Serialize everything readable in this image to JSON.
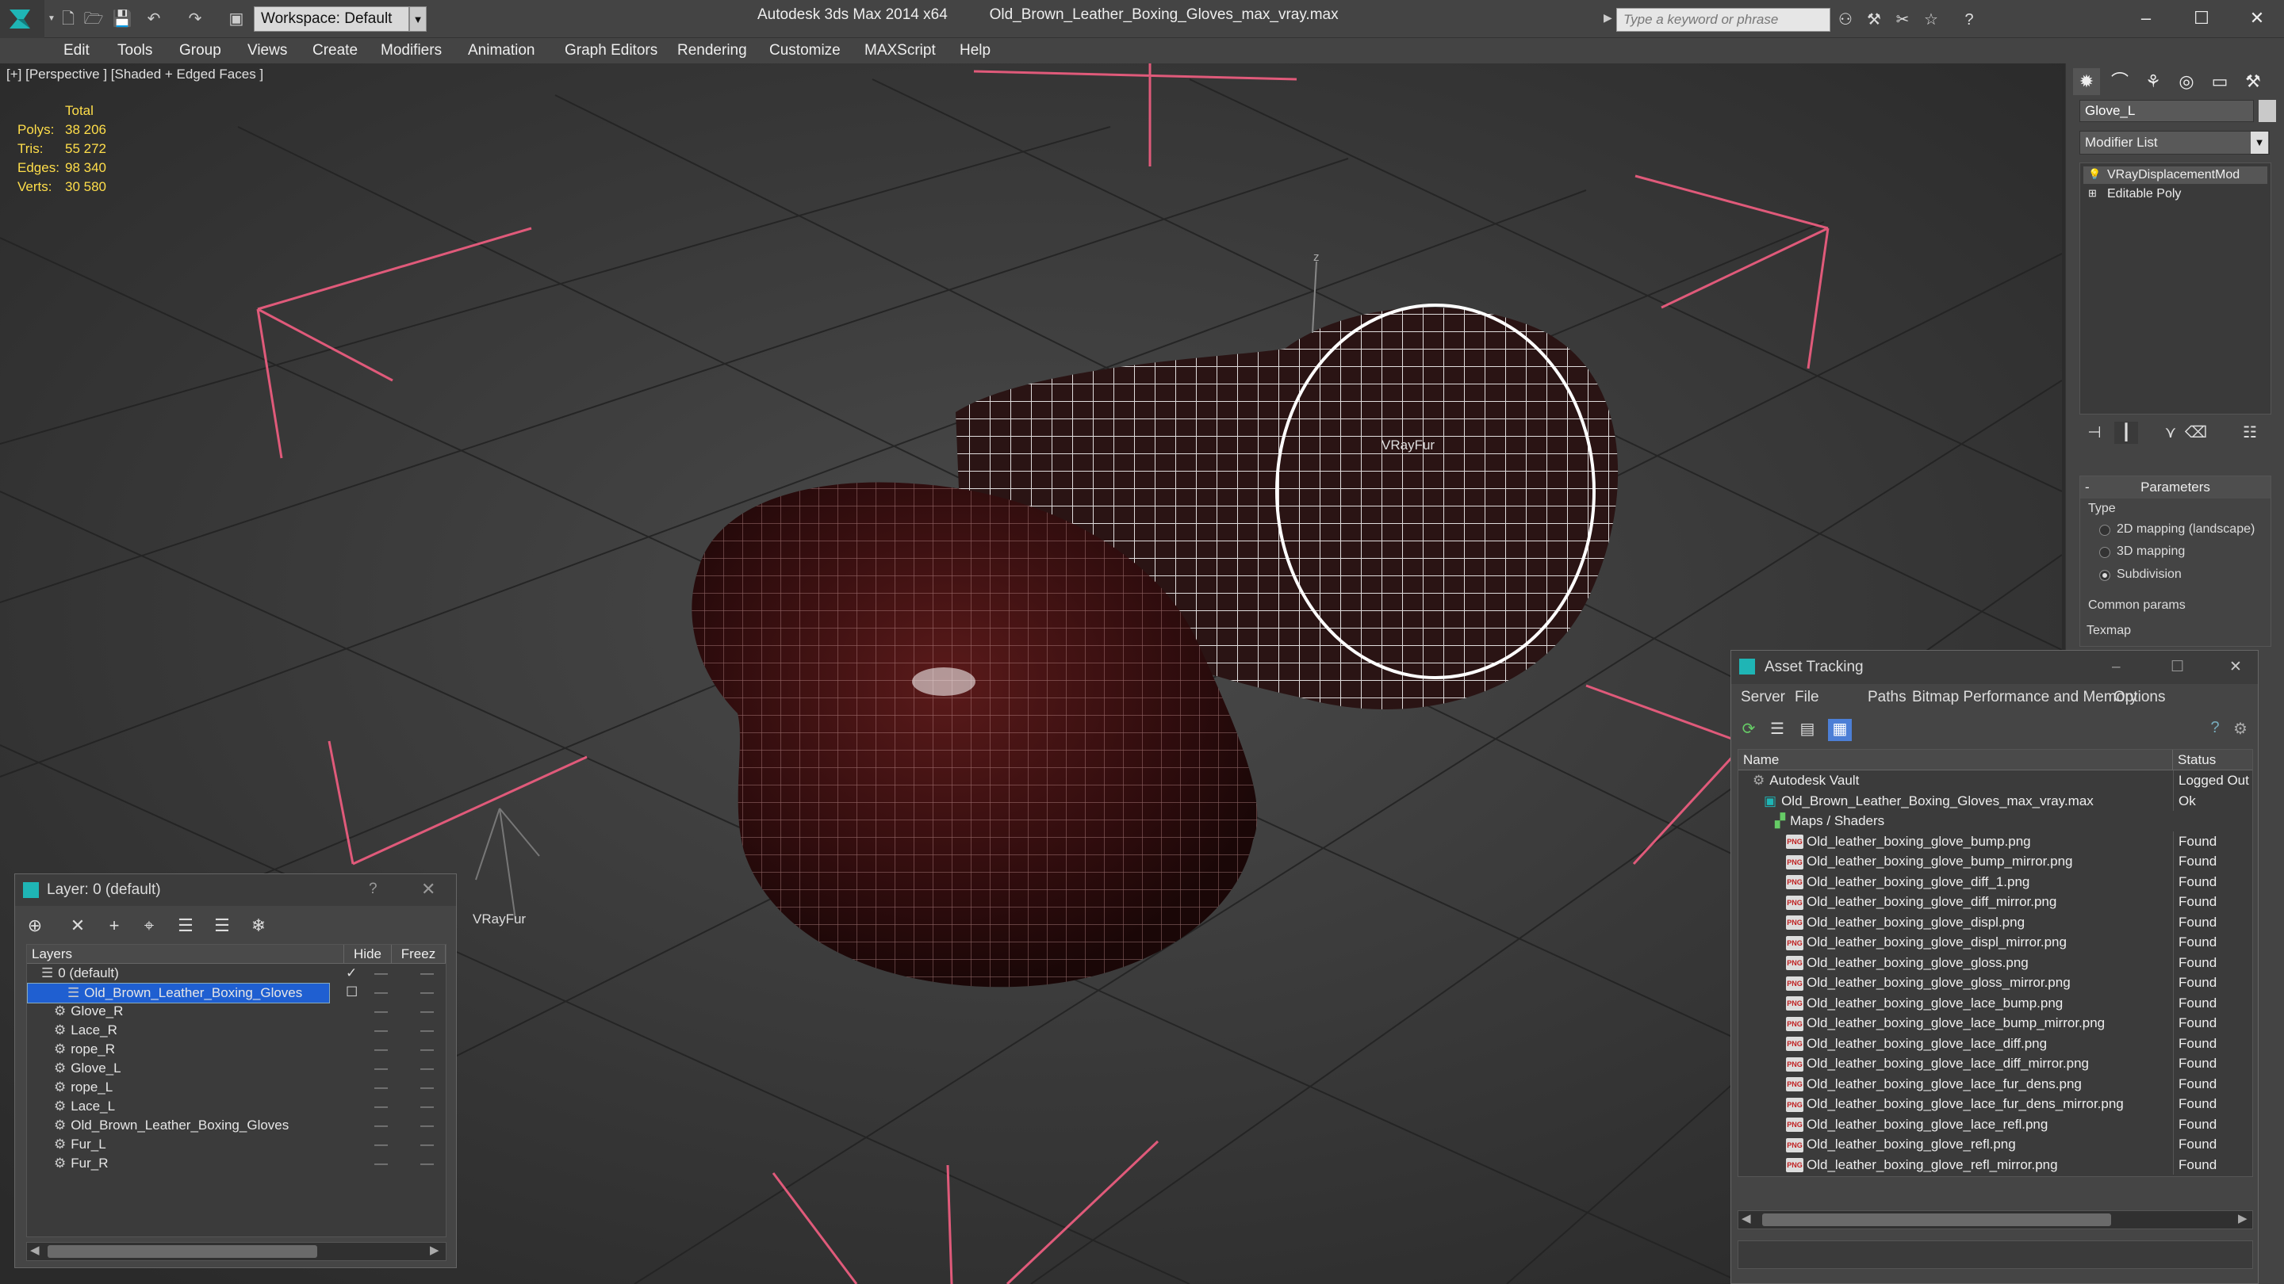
{
  "app": {
    "title": "Autodesk 3ds Max 2014 x64",
    "filename": "Old_Brown_Leather_Boxing_Gloves_max_vray.max",
    "workspace": "Workspace: Default",
    "search_placeholder": "Type a keyword or phrase"
  },
  "menu": [
    "Edit",
    "Tools",
    "Group",
    "Views",
    "Create",
    "Modifiers",
    "Animation",
    "Graph Editors",
    "Rendering",
    "Customize",
    "MAXScript",
    "Help"
  ],
  "viewport": {
    "label": "[+] [Perspective ] [Shaded + Edged Faces ]",
    "stats": {
      "header": "Total",
      "rows": [
        {
          "label": "Polys:",
          "value": "38 206"
        },
        {
          "label": "Tris:",
          "value": "55 272"
        },
        {
          "label": "Edges:",
          "value": "98 340"
        },
        {
          "label": "Verts:",
          "value": "30 580"
        }
      ]
    },
    "fur_labels": [
      "VRayFur",
      "VRayFur"
    ],
    "axis_label": "z"
  },
  "command_panel": {
    "object_name": "Glove_L",
    "modifier_list": "Modifier List",
    "stack": [
      "VRayDisplacementMod",
      "Editable Poly"
    ],
    "parameters": {
      "header": "Parameters",
      "type_label": "Type",
      "options": [
        "2D mapping (landscape)",
        "3D mapping",
        "Subdivision"
      ],
      "selected": "Subdivision",
      "common_params": "Common params",
      "texmap": "Texmap"
    }
  },
  "asset_tracking": {
    "title": "Asset Tracking",
    "menu": [
      "Server",
      "File",
      "Paths",
      "Bitmap Performance and Memory",
      "Options"
    ],
    "columns": [
      "Name",
      "Status"
    ],
    "rows": [
      {
        "name": "Autodesk Vault",
        "status": "Logged Out",
        "level": 0,
        "icon": "vault"
      },
      {
        "name": "Old_Brown_Leather_Boxing_Gloves_max_vray.max",
        "status": "Ok",
        "level": 1,
        "icon": "max"
      },
      {
        "name": "Maps / Shaders",
        "status": "",
        "level": 2,
        "icon": "maps"
      },
      {
        "name": "Old_leather_boxing_glove_bump.png",
        "status": "Found",
        "level": 3,
        "icon": "png"
      },
      {
        "name": "Old_leather_boxing_glove_bump_mirror.png",
        "status": "Found",
        "level": 3,
        "icon": "png"
      },
      {
        "name": "Old_leather_boxing_glove_diff_1.png",
        "status": "Found",
        "level": 3,
        "icon": "png"
      },
      {
        "name": "Old_leather_boxing_glove_diff_mirror.png",
        "status": "Found",
        "level": 3,
        "icon": "png"
      },
      {
        "name": "Old_leather_boxing_glove_displ.png",
        "status": "Found",
        "level": 3,
        "icon": "png"
      },
      {
        "name": "Old_leather_boxing_glove_displ_mirror.png",
        "status": "Found",
        "level": 3,
        "icon": "png"
      },
      {
        "name": "Old_leather_boxing_glove_gloss.png",
        "status": "Found",
        "level": 3,
        "icon": "png"
      },
      {
        "name": "Old_leather_boxing_glove_gloss_mirror.png",
        "status": "Found",
        "level": 3,
        "icon": "png"
      },
      {
        "name": "Old_leather_boxing_glove_lace_bump.png",
        "status": "Found",
        "level": 3,
        "icon": "png"
      },
      {
        "name": "Old_leather_boxing_glove_lace_bump_mirror.png",
        "status": "Found",
        "level": 3,
        "icon": "png"
      },
      {
        "name": "Old_leather_boxing_glove_lace_diff.png",
        "status": "Found",
        "level": 3,
        "icon": "png"
      },
      {
        "name": "Old_leather_boxing_glove_lace_diff_mirror.png",
        "status": "Found",
        "level": 3,
        "icon": "png"
      },
      {
        "name": "Old_leather_boxing_glove_lace_fur_dens.png",
        "status": "Found",
        "level": 3,
        "icon": "png"
      },
      {
        "name": "Old_leather_boxing_glove_lace_fur_dens_mirror.png",
        "status": "Found",
        "level": 3,
        "icon": "png"
      },
      {
        "name": "Old_leather_boxing_glove_lace_refl.png",
        "status": "Found",
        "level": 3,
        "icon": "png"
      },
      {
        "name": "Old_leather_boxing_glove_refl.png",
        "status": "Found",
        "level": 3,
        "icon": "png"
      },
      {
        "name": "Old_leather_boxing_glove_refl_mirror.png",
        "status": "Found",
        "level": 3,
        "icon": "png"
      }
    ]
  },
  "layer_manager": {
    "title": "Layer: 0 (default)",
    "help": "?",
    "columns": [
      "Layers",
      "Hide",
      "Freez"
    ],
    "rows": [
      {
        "name": "0 (default)",
        "level": 0,
        "selected": false,
        "active": true
      },
      {
        "name": "Old_Brown_Leather_Boxing_Gloves",
        "level": 0,
        "selected": true,
        "active": false
      },
      {
        "name": "Glove_R",
        "level": 1
      },
      {
        "name": "Lace_R",
        "level": 1
      },
      {
        "name": "rope_R",
        "level": 1
      },
      {
        "name": "Glove_L",
        "level": 1
      },
      {
        "name": "rope_L",
        "level": 1
      },
      {
        "name": "Lace_L",
        "level": 1
      },
      {
        "name": "Old_Brown_Leather_Boxing_Gloves",
        "level": 1
      },
      {
        "name": "Fur_L",
        "level": 1
      },
      {
        "name": "Fur_R",
        "level": 1
      }
    ]
  },
  "colors": {
    "accent_selection": "#1f5fd1",
    "stats_yellow": "#ffde4a",
    "bbox_pink": "#e05a7a",
    "glove_dark": "#3a0f10",
    "wire_white": "#ffffff"
  }
}
